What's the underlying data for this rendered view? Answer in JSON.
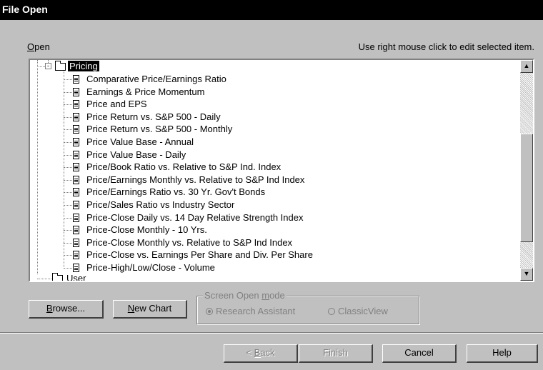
{
  "window": {
    "title": "File Open"
  },
  "open_label": {
    "accel": "O",
    "rest": "pen"
  },
  "hint": "Use right mouse click to edit selected item.",
  "tree": {
    "selected_folder": "Pricing",
    "items": [
      "Comparative Price/Earnings Ratio",
      "Earnings & Price Momentum",
      "Price and EPS",
      "Price Return vs. S&P 500 - Daily",
      "Price Return vs. S&P 500 - Monthly",
      "Price Value Base - Annual",
      "Price Value Base - Daily",
      "Price/Book Ratio vs. Relative to S&P Ind. Index",
      "Price/Earnings Monthly vs. Relative to S&P Ind Index",
      "Price/Earnings Ratio vs. 30 Yr. Gov't Bonds",
      "Price/Sales Ratio vs Industry Sector",
      "Price-Close Daily vs. 14 Day Relative Strength Index",
      "Price-Close Monthly - 10 Yrs.",
      "Price-Close Monthly vs. Relative to S&P Ind Index",
      "Price-Close vs. Earnings Per Share and Div. Per Share",
      "Price-High/Low/Close - Volume"
    ],
    "partial_folder": "User"
  },
  "buttons": {
    "browse": {
      "accel": "B",
      "rest": "rowse..."
    },
    "new_chart": {
      "accel": "N",
      "rest": "ew Chart"
    },
    "back": {
      "prefix": "< ",
      "accel": "B",
      "rest": "ack"
    },
    "finish": "Finish",
    "cancel": "Cancel",
    "help": "Help"
  },
  "screen_open_mode": {
    "legend_prefix": "Screen Open ",
    "legend_accel": "m",
    "legend_rest": "ode",
    "options": [
      {
        "label": "Research Assistant",
        "checked": true
      },
      {
        "label": "ClassicView",
        "checked": false
      }
    ]
  },
  "colors": {
    "dialog_bg": "#c0c0c0",
    "titlebar_bg": "#000000",
    "selection_bg": "#000000",
    "disabled_text": "#808080"
  }
}
